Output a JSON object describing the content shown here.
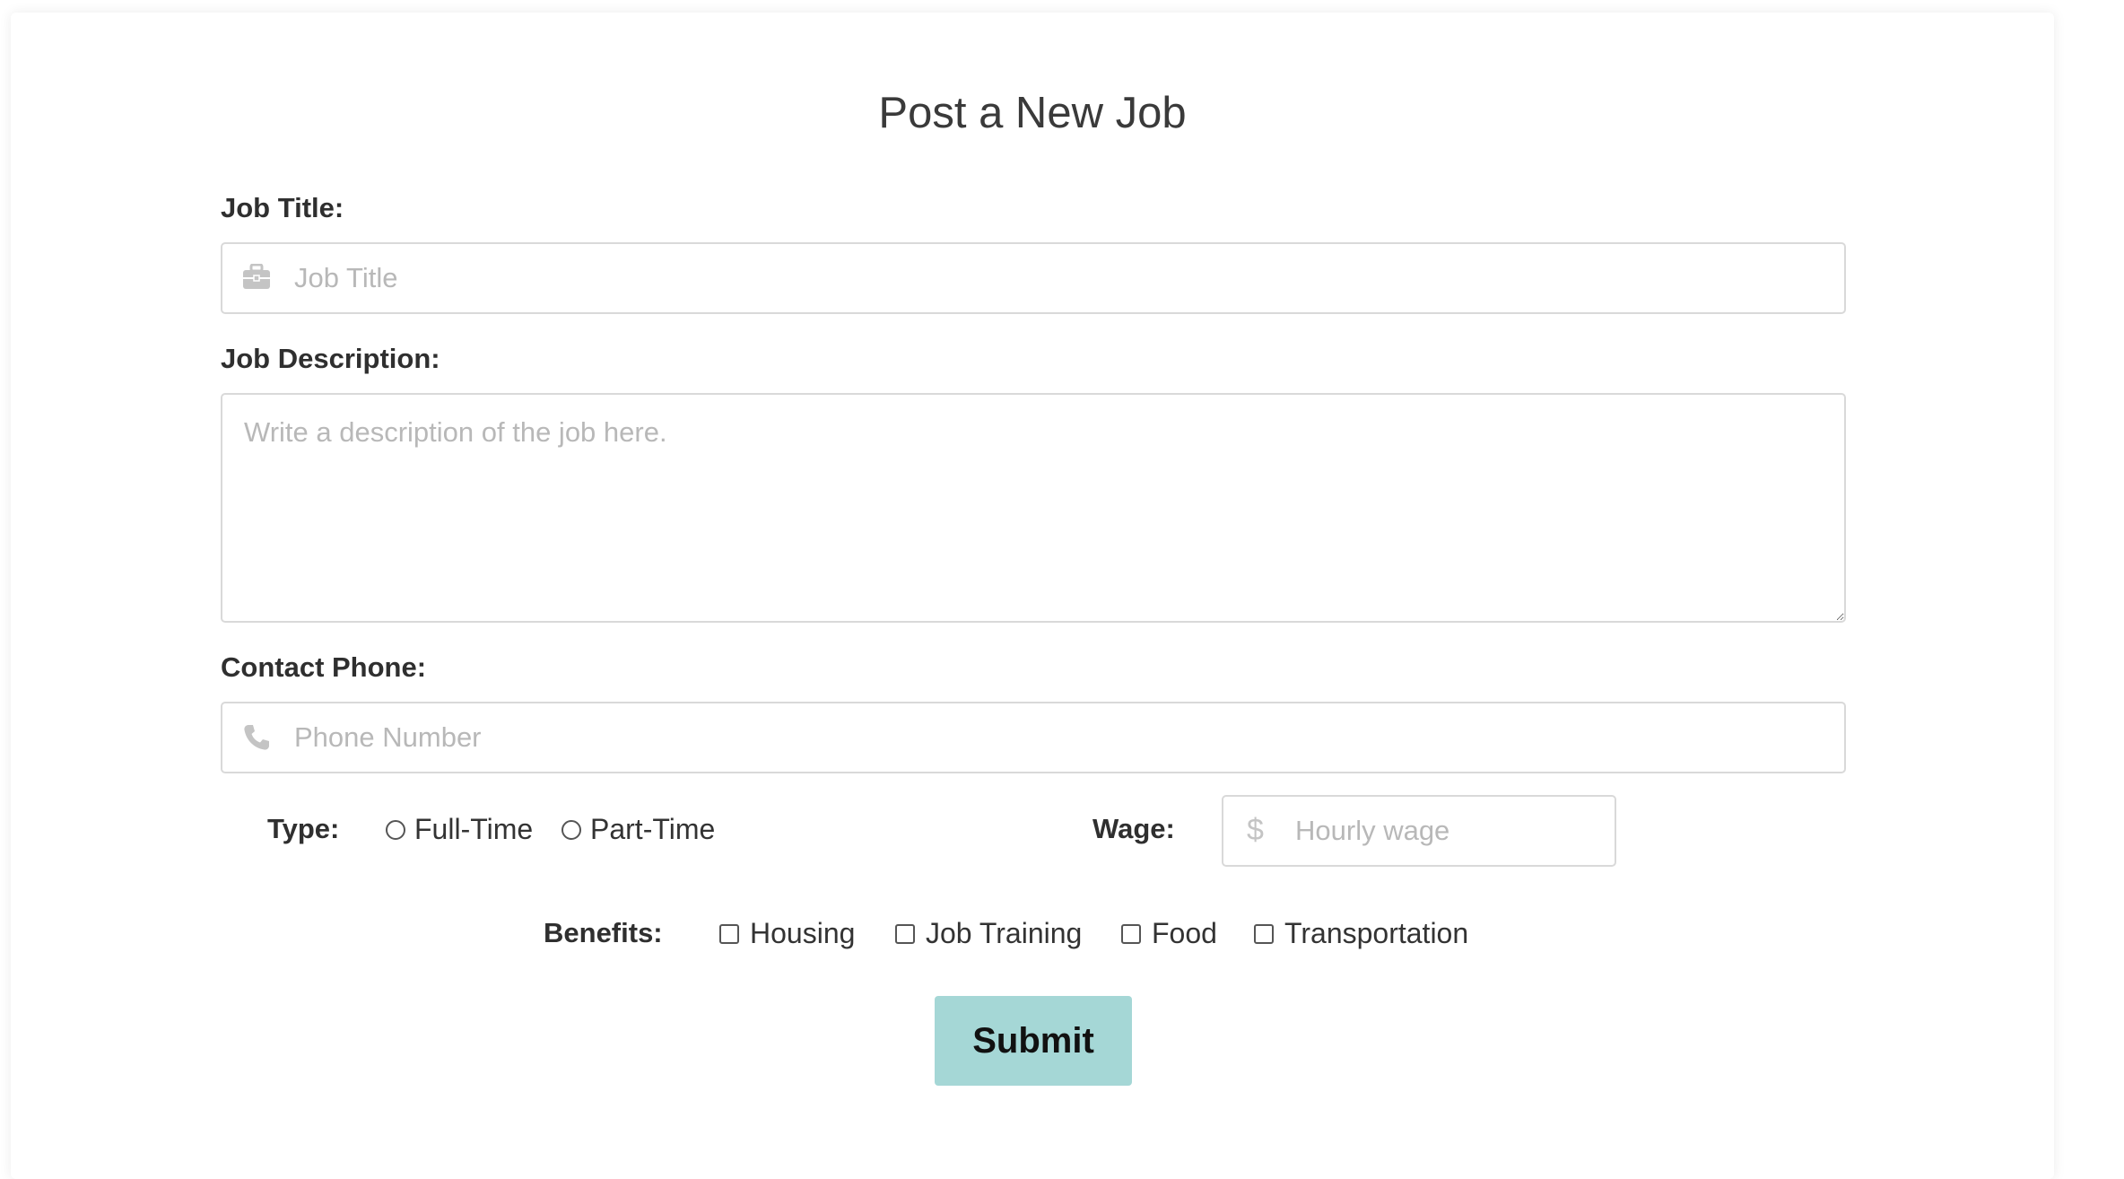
{
  "page": {
    "title": "Post a New Job"
  },
  "form": {
    "job_title": {
      "label": "Job Title:",
      "placeholder": "Job Title",
      "value": "",
      "icon": "briefcase-icon"
    },
    "job_description": {
      "label": "Job Description:",
      "placeholder": "Write a description of the job here.",
      "value": ""
    },
    "contact_phone": {
      "label": "Contact Phone:",
      "placeholder": "Phone Number",
      "value": "",
      "icon": "phone-icon"
    },
    "type": {
      "label": "Type:",
      "options": [
        "Full-Time",
        "Part-Time"
      ],
      "selected": null
    },
    "wage": {
      "label": "Wage:",
      "placeholder": "Hourly wage",
      "value": "",
      "icon": "dollar-icon"
    },
    "benefits": {
      "label": "Benefits:",
      "options": [
        "Housing",
        "Job Training",
        "Food",
        "Transportation"
      ],
      "checked": [
        false,
        false,
        false,
        false
      ]
    },
    "submit_label": "Submit"
  },
  "colors": {
    "submit_bg": "#a5d7d6",
    "placeholder": "#b8b8b8",
    "input_border": "#d9d9d9"
  }
}
